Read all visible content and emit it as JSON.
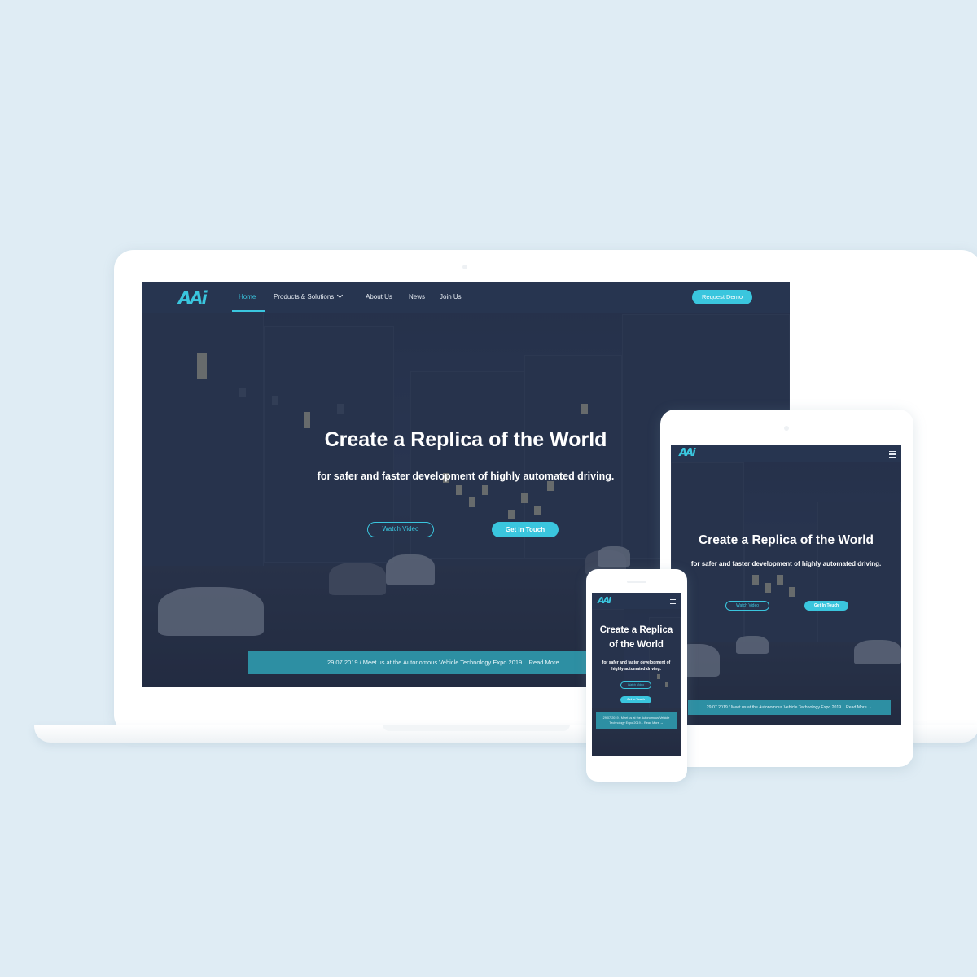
{
  "brand": {
    "logo_text": "AAi",
    "accent_color": "#3ac6de",
    "nav_bg_color": "#273550",
    "news_bar_color": "#2d8fa3"
  },
  "nav": {
    "items": [
      {
        "label": "Home",
        "active": true
      },
      {
        "label": "Products & Solutions",
        "has_dropdown": true
      },
      {
        "label": "About Us"
      },
      {
        "label": "News"
      },
      {
        "label": "Join Us"
      }
    ],
    "cta_label": "Request Demo",
    "menu_icon": "hamburger-menu-icon"
  },
  "hero": {
    "title": "Create a Replica of the World",
    "subtitle": "for safer and faster development of highly automated driving.",
    "watch_video_label": "Watch Video",
    "get_in_touch_label": "Get In Touch"
  },
  "news_banner": {
    "laptop_text": "29.07.2019 / Meet us at the Autonomous Vehicle Technology Expo 2019... Read More",
    "tablet_text": "29.07.2019 / Meet us at the Autonomous Vehicle Technology Expo 2019... Read More →",
    "phone_text": "29.07.2019 / Meet us at the Autonomous Vehicle Technology Expo 2019... Read More →"
  }
}
